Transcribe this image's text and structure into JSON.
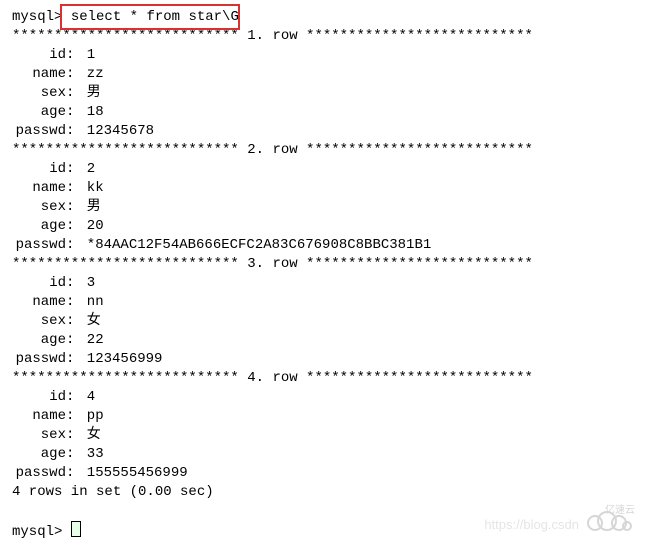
{
  "prompt": "mysql>",
  "query": "select * from star\\G",
  "stars": "***************************",
  "rows": [
    {
      "idx": "1",
      "fields": [
        {
          "k": "id",
          "v": "1"
        },
        {
          "k": "name",
          "v": "zz"
        },
        {
          "k": "sex",
          "v": "男"
        },
        {
          "k": "age",
          "v": "18"
        },
        {
          "k": "passwd",
          "v": "12345678"
        }
      ]
    },
    {
      "idx": "2",
      "fields": [
        {
          "k": "id",
          "v": "2"
        },
        {
          "k": "name",
          "v": "kk"
        },
        {
          "k": "sex",
          "v": "男"
        },
        {
          "k": "age",
          "v": "20"
        },
        {
          "k": "passwd",
          "v": "*84AAC12F54AB666ECFC2A83C676908C8BBC381B1"
        }
      ]
    },
    {
      "idx": "3",
      "fields": [
        {
          "k": "id",
          "v": "3"
        },
        {
          "k": "name",
          "v": "nn"
        },
        {
          "k": "sex",
          "v": "女"
        },
        {
          "k": "age",
          "v": "22"
        },
        {
          "k": "passwd",
          "v": "123456999"
        }
      ]
    },
    {
      "idx": "4",
      "fields": [
        {
          "k": "id",
          "v": "4"
        },
        {
          "k": "name",
          "v": "pp"
        },
        {
          "k": "sex",
          "v": "女"
        },
        {
          "k": "age",
          "v": "33"
        },
        {
          "k": "passwd",
          "v": "155555456999"
        }
      ]
    }
  ],
  "summary": "4 rows in set (0.00 sec)",
  "watermark": "https://blog.csdn",
  "logo_text": "亿速云"
}
